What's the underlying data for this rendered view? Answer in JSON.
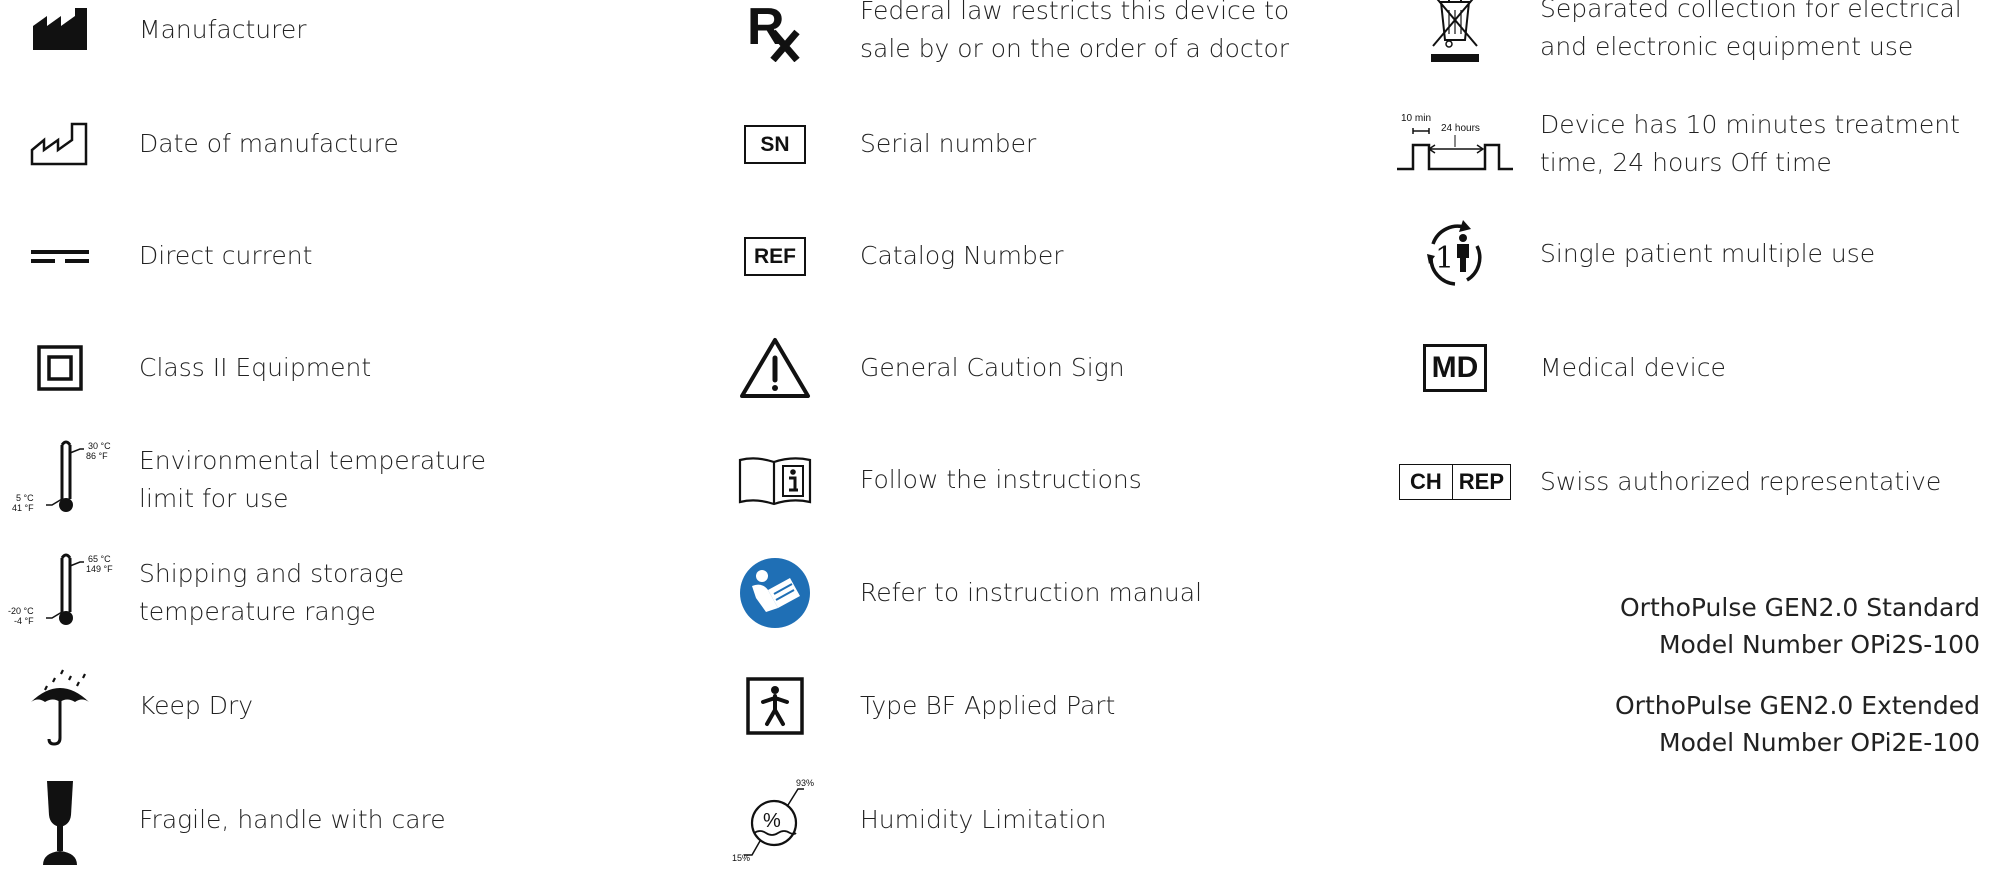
{
  "column1": [
    {
      "icon": "manufacturer-icon",
      "label": "Manufacturer"
    },
    {
      "icon": "date-of-manufacture-icon",
      "label": "Date of manufacture"
    },
    {
      "icon": "direct-current-icon",
      "label": "Direct current"
    },
    {
      "icon": "class-ii-equipment-icon",
      "label": "Class II Equipment"
    },
    {
      "icon": "thermometer-icon",
      "label": "Environmental temperature limit for use",
      "line1": "Environmental temperature",
      "line2": "limit for use",
      "temp_high_c": "30 °C",
      "temp_high_f": "86 °F",
      "temp_low_c": "5 °C",
      "temp_low_f": "41 °F"
    },
    {
      "icon": "thermometer-icon",
      "label": "Shipping and storage temperature range",
      "line1": "Shipping and storage",
      "line2": "temperature range",
      "temp_high_c": "65 °C",
      "temp_high_f": "149 °F",
      "temp_low_c": "-20 °C",
      "temp_low_f": "-4 °F"
    },
    {
      "icon": "umbrella-icon",
      "label": "Keep Dry"
    },
    {
      "icon": "fragile-glass-icon",
      "label": "Fragile, handle with care"
    }
  ],
  "column2": [
    {
      "icon": "rx-icon",
      "symbol": "Rx",
      "line1": "Federal law restricts this device to",
      "line2": "sale by or on the order of a doctor"
    },
    {
      "icon": "serial-number-icon",
      "symbol": "SN",
      "label": "Serial number"
    },
    {
      "icon": "catalog-number-icon",
      "symbol": "REF",
      "label": "Catalog Number"
    },
    {
      "icon": "caution-icon",
      "label": "General Caution Sign"
    },
    {
      "icon": "instructions-book-icon",
      "label": "Follow the instructions"
    },
    {
      "icon": "manual-reading-icon",
      "label": "Refer to instruction manual"
    },
    {
      "icon": "type-bf-icon",
      "label": "Type BF Applied Part"
    },
    {
      "icon": "humidity-icon",
      "label": "Humidity Limitation",
      "humidity_high": "93%",
      "humidity_low": "15%"
    }
  ],
  "column3": [
    {
      "icon": "crossed-bin-icon",
      "line1": "Separated collection for electrical",
      "line2": "and electronic equipment use"
    },
    {
      "icon": "treatment-time-icon",
      "line1": "Device has 10 minutes treatment",
      "line2": "time, 24 hours Off time",
      "time_on": "10 min",
      "time_off": "24 hours"
    },
    {
      "icon": "single-patient-icon",
      "label": "Single patient multiple use",
      "number": "1"
    },
    {
      "icon": "medical-device-icon",
      "symbol": "MD",
      "label": "Medical device"
    },
    {
      "icon": "swiss-rep-icon",
      "symbol_left": "CH",
      "symbol_right": "REP",
      "label": "Swiss authorized representative"
    }
  ],
  "models": [
    {
      "name": "OrthoPulse GEN2.0 Standard",
      "number": "Model Number OPi2S-100"
    },
    {
      "name": "OrthoPulse GEN2.0 Extended",
      "number": "Model Number OPi2E-100"
    }
  ],
  "colors": {
    "text": "#222222",
    "icon": "#111111",
    "manual_blue": "#1f6fb5"
  }
}
